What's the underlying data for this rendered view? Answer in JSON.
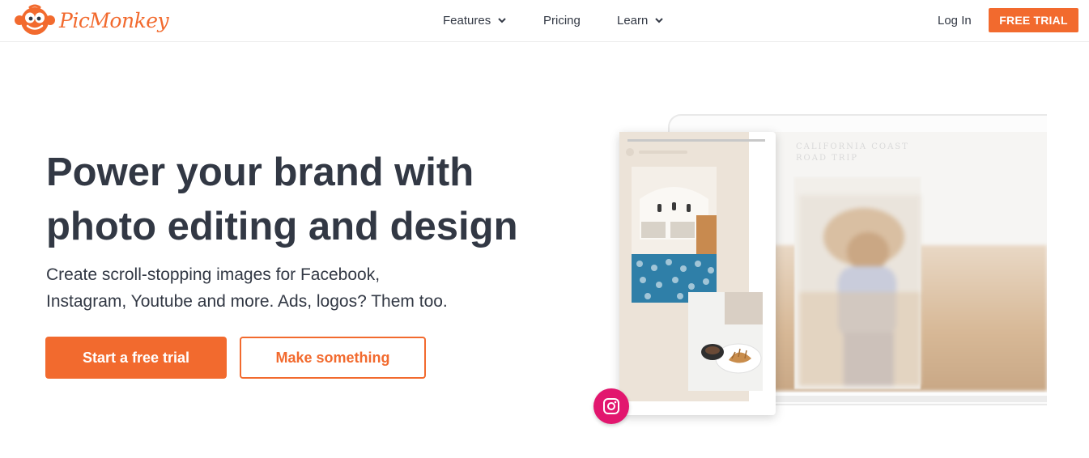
{
  "brand": {
    "name": "PicMonkey",
    "accent": "#f26a2e"
  },
  "nav": {
    "features": "Features",
    "pricing": "Pricing",
    "learn": "Learn",
    "login": "Log In",
    "free_trial": "FREE TRIAL"
  },
  "hero": {
    "title_line1": "Power your brand with",
    "title_line2": "photo editing and design",
    "subtitle_line1": "Create scroll-stopping images for Facebook,",
    "subtitle_line2": "Instagram, Youtube and more. Ads, logos? Them too.",
    "primary_cta": "Start a free trial",
    "secondary_cta": "Make something"
  },
  "illustration": {
    "screen_caption_line1": "CALIFORNIA COAST",
    "screen_caption_line2": "ROAD TRIP",
    "social_icon": "instagram-icon",
    "social_color": "#e2166e"
  }
}
